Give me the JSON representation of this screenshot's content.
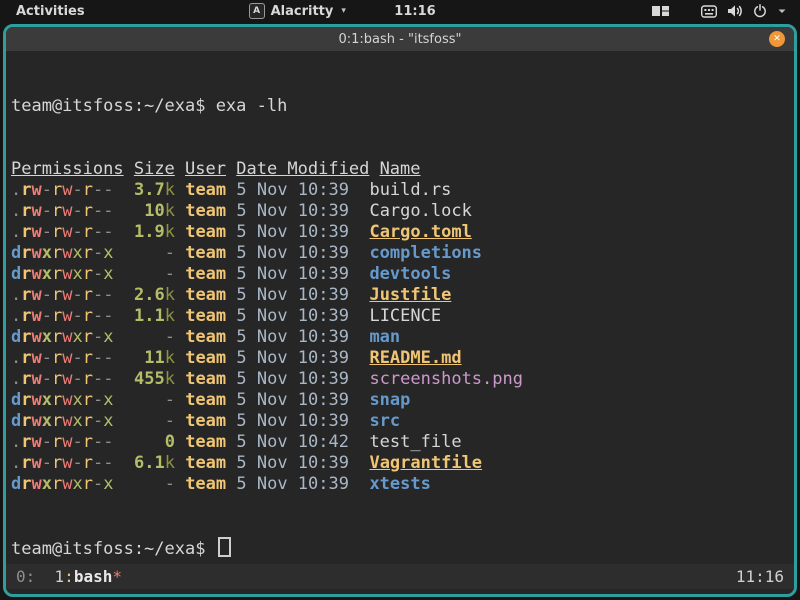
{
  "top_bar": {
    "activities_label": "Activities",
    "app_menu": {
      "icon_letter": "A",
      "label": "Alacritty",
      "chevron": "▾"
    },
    "clock": "11:16",
    "tray_icons": [
      "tiling-layout-icon",
      "keyboard-icon",
      "volume-icon",
      "power-icon",
      "chevron-down-icon"
    ]
  },
  "window": {
    "title": "0:1:bash - \"itsfoss\"",
    "close_glyph": "✕",
    "border_color": "#2f9e9e",
    "close_color": "#f0973a"
  },
  "terminal": {
    "command_line": "team@itsfoss:~/exa$ exa -lh",
    "prompt": "team@itsfoss:~/exa$ ",
    "listing": {
      "headers": [
        "Permissions",
        "Size",
        "User",
        "Date Modified",
        "Name"
      ],
      "rows": [
        {
          "perms": ".rw-rw-r--",
          "size": "3.7k",
          "user": "team",
          "date": "5 Nov 10:39",
          "name": "build.rs",
          "type": "plain"
        },
        {
          "perms": ".rw-rw-r--",
          "size": "10k",
          "user": "team",
          "date": "5 Nov 10:39",
          "name": "Cargo.lock",
          "type": "plain"
        },
        {
          "perms": ".rw-rw-r--",
          "size": "1.9k",
          "user": "team",
          "date": "5 Nov 10:39",
          "name": "Cargo.toml",
          "type": "build"
        },
        {
          "perms": "drwxrwxr-x",
          "size": "-",
          "user": "team",
          "date": "5 Nov 10:39",
          "name": "completions",
          "type": "dir"
        },
        {
          "perms": "drwxrwxr-x",
          "size": "-",
          "user": "team",
          "date": "5 Nov 10:39",
          "name": "devtools",
          "type": "dir"
        },
        {
          "perms": ".rw-rw-r--",
          "size": "2.6k",
          "user": "team",
          "date": "5 Nov 10:39",
          "name": "Justfile",
          "type": "build"
        },
        {
          "perms": ".rw-rw-r--",
          "size": "1.1k",
          "user": "team",
          "date": "5 Nov 10:39",
          "name": "LICENCE",
          "type": "plain"
        },
        {
          "perms": "drwxrwxr-x",
          "size": "-",
          "user": "team",
          "date": "5 Nov 10:39",
          "name": "man",
          "type": "dir"
        },
        {
          "perms": ".rw-rw-r--",
          "size": "11k",
          "user": "team",
          "date": "5 Nov 10:39",
          "name": "README.md",
          "type": "build"
        },
        {
          "perms": ".rw-rw-r--",
          "size": "455k",
          "user": "team",
          "date": "5 Nov 10:39",
          "name": "screenshots.png",
          "type": "image"
        },
        {
          "perms": "drwxrwxr-x",
          "size": "-",
          "user": "team",
          "date": "5 Nov 10:39",
          "name": "snap",
          "type": "dir"
        },
        {
          "perms": "drwxrwxr-x",
          "size": "-",
          "user": "team",
          "date": "5 Nov 10:39",
          "name": "src",
          "type": "dir"
        },
        {
          "perms": ".rw-rw-r--",
          "size": "0",
          "user": "team",
          "date": "5 Nov 10:42",
          "name": "test_file",
          "type": "plain"
        },
        {
          "perms": ".rw-rw-r--",
          "size": "6.1k",
          "user": "team",
          "date": "5 Nov 10:39",
          "name": "Vagrantfile",
          "type": "build"
        },
        {
          "perms": "drwxrwxr-x",
          "size": "-",
          "user": "team",
          "date": "5 Nov 10:39",
          "name": "xtests",
          "type": "dir"
        }
      ]
    },
    "status_bar": {
      "session_prefix": "0:",
      "window_index": "1",
      "separator": ":",
      "window_name": "bash",
      "active_marker": "*",
      "clock": "11:16"
    }
  },
  "colors": {
    "terminal_bg": "#262626",
    "titlebar_bg": "#3b3b3b",
    "topbar_bg": "#161616",
    "accent_teal": "#2f9e9e",
    "yellow": "#f0c674",
    "red": "#ee7b74",
    "green": "#b5bd68",
    "blue": "#6699cc",
    "purple": "#cc99cc",
    "date_blue": "#a9b7c6"
  }
}
